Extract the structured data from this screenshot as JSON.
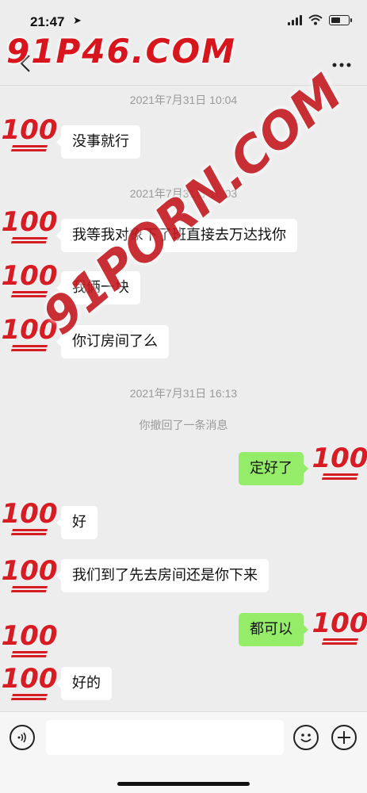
{
  "status_bar": {
    "time": "21:47",
    "battery_level": 0.55
  },
  "watermarks": {
    "logo": "91P46.COM",
    "diagonal": "91PORN.COM"
  },
  "avatar_text": "100",
  "messages": [
    {
      "kind": "timestamp",
      "text": "2021年7月31日 10:04"
    },
    {
      "kind": "recv",
      "text": "没事就行"
    },
    {
      "kind": "timestamp",
      "text": "2021年7月31日 16:03"
    },
    {
      "kind": "recv",
      "text": "我等我对象下了班直接去万达找你"
    },
    {
      "kind": "recv",
      "text": "我俩一块"
    },
    {
      "kind": "recv",
      "text": "你订房间了么"
    },
    {
      "kind": "timestamp",
      "text": "2021年7月31日 16:13"
    },
    {
      "kind": "system",
      "text": "你撤回了一条消息"
    },
    {
      "kind": "sent",
      "text": "定好了"
    },
    {
      "kind": "recv",
      "text": "好"
    },
    {
      "kind": "recv",
      "text": "我们到了先去房间还是你下来"
    },
    {
      "kind": "sent",
      "text": "都可以"
    },
    {
      "kind": "recv",
      "text": "好的"
    }
  ],
  "colors": {
    "sent_bubble": "#95ec69",
    "recv_bubble": "#ffffff",
    "background": "#ededed",
    "watermark_red": "#d81c24"
  },
  "icons": [
    "back-icon",
    "more-icon",
    "voice-icon",
    "emoji-icon",
    "plus-icon"
  ]
}
